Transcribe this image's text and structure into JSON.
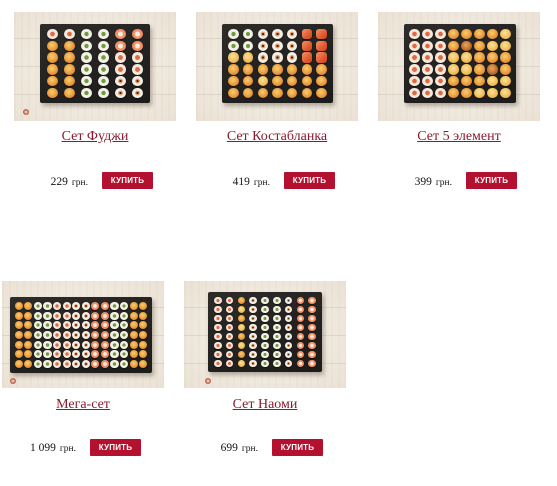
{
  "colors": {
    "link": "#8b1a2e",
    "button": "#b3112f",
    "button_text": "#ffffff"
  },
  "products": [
    {
      "name": "Сет Фуджи",
      "price": "229",
      "currency": "грн.",
      "buy_label": "КУПИТЬ"
    },
    {
      "name": "Сет Костабланка",
      "price": "419",
      "currency": "грн.",
      "buy_label": "КУПИТЬ"
    },
    {
      "name": "Сет 5 элемент",
      "price": "399",
      "currency": "грн.",
      "buy_label": "КУПИТЬ"
    },
    {
      "name": "Мега-сет",
      "price": "1 099",
      "currency": "грн.",
      "buy_label": "КУПИТЬ"
    },
    {
      "name": "Сет Наоми",
      "price": "699",
      "currency": "грн.",
      "buy_label": "КУПИТЬ"
    }
  ]
}
